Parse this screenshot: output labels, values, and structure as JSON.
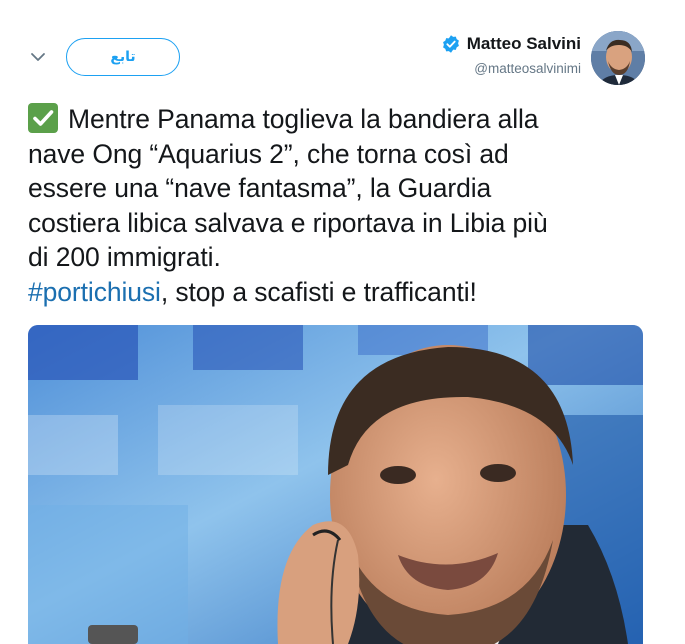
{
  "author": {
    "display_name": "Matteo Salvini",
    "handle": "@matteosalvinimi",
    "verified": true,
    "avatar_icon": "profile-photo"
  },
  "follow_button": {
    "label": "تابع"
  },
  "menu_icon": "chevron-down-icon",
  "tweet": {
    "emoji": "white-heavy-check-mark",
    "text_main": "Mentre Panama toglieva la bandiera alla\nnave Ong “Aquarius 2”, che torna così ad\nessere una “nave fantasma”, la Guardia\ncostiera libica salvava e riportava in Libia più\ndi 200 immigrati.",
    "hashtag": "#portichiusi",
    "text_after_hashtag": ", stop a scafisti e trafficanti!"
  },
  "media": {
    "type": "photo"
  },
  "colors": {
    "accent": "#1da1f2",
    "hashtag": "#1b6fb0",
    "text": "#14171a",
    "secondary": "#657786",
    "checkmark_bg": "#5ba04a"
  }
}
